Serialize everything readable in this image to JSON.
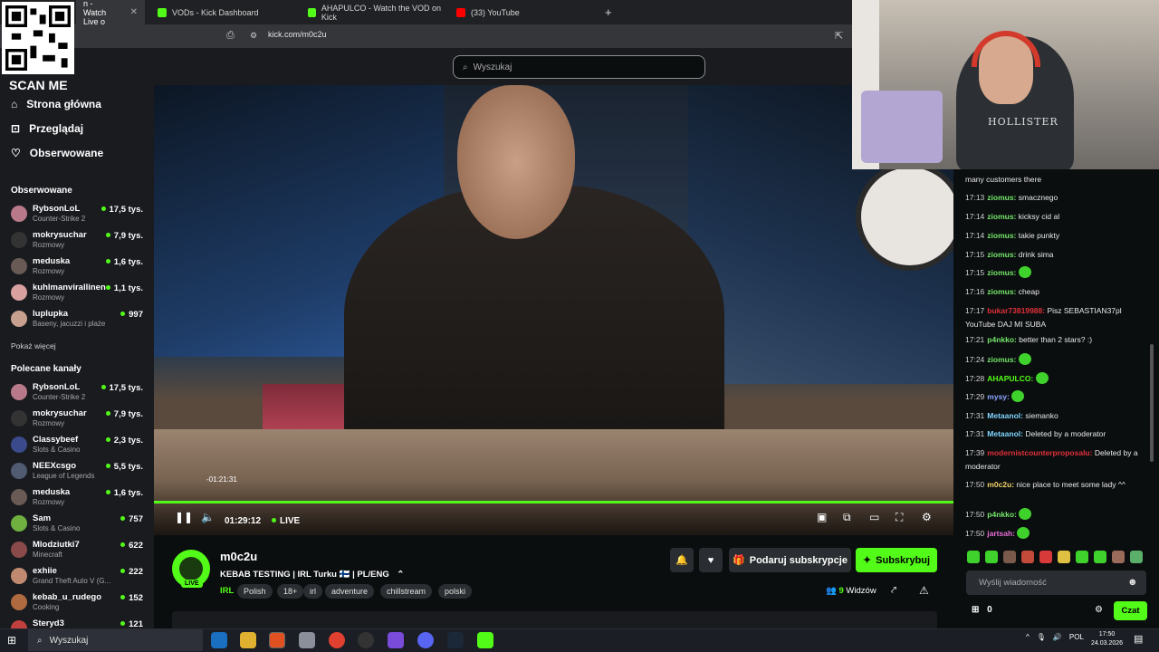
{
  "browser": {
    "tabs": [
      {
        "label": "n - Watch Live o",
        "color": "#53fc18"
      },
      {
        "label": "VODs - Kick Dashboard",
        "color": "#53fc18"
      },
      {
        "label": "AHAPULCO - Watch the VOD on Kick",
        "color": "#53fc18"
      },
      {
        "label": "(33) YouTube",
        "color": "#ff0000"
      }
    ],
    "url": "kick.com/m0c2u"
  },
  "overlay": {
    "scan_me": "SCAN ME"
  },
  "header": {
    "search_placeholder": "Wyszukaj"
  },
  "sidebar": {
    "nav": [
      {
        "label": "Strona główna",
        "icon": "home-icon"
      },
      {
        "label": "Przeglądaj",
        "icon": "browse-icon"
      },
      {
        "label": "Obserwowane",
        "icon": "heart-icon"
      }
    ],
    "followed_title": "Obserwowane",
    "followed": [
      {
        "name": "RybsonLoL",
        "category": "Counter-Strike 2",
        "viewers": "17,5 tys.",
        "color": "#b87a8a"
      },
      {
        "name": "mokrysuchar",
        "category": "Rozmowy",
        "viewers": "7,9 tys.",
        "color": "#333"
      },
      {
        "name": "meduska",
        "category": "Rozmowy",
        "viewers": "1,6 tys.",
        "color": "#6a5a55"
      },
      {
        "name": "kuhlmanvirallinen",
        "category": "Rozmowy",
        "viewers": "1,1 tys.",
        "color": "#d9a0a0"
      },
      {
        "name": "luplupka",
        "category": "Baseny, jacuzzi i plaże",
        "viewers": "997",
        "color": "#c8a090"
      }
    ],
    "show_more": "Pokaż więcej",
    "recommended_title": "Polecane kanały",
    "recommended": [
      {
        "name": "RybsonLoL",
        "category": "Counter-Strike 2",
        "viewers": "17,5 tys.",
        "color": "#b87a8a"
      },
      {
        "name": "mokrysuchar",
        "category": "Rozmowy",
        "viewers": "7,9 tys.",
        "color": "#333"
      },
      {
        "name": "Classybeef",
        "category": "Slots & Casino",
        "viewers": "2,3 tys.",
        "color": "#3a4a8a"
      },
      {
        "name": "NEEXcsgo",
        "category": "League of Legends",
        "viewers": "5,5 tys.",
        "color": "#505a70"
      },
      {
        "name": "meduska",
        "category": "Rozmowy",
        "viewers": "1,6 tys.",
        "color": "#6a5a55"
      },
      {
        "name": "Sam",
        "category": "Slots & Casino",
        "viewers": "757",
        "color": "#6fb040"
      },
      {
        "name": "Mlodziutki7",
        "category": "Minecraft",
        "viewers": "622",
        "color": "#8a4a4a"
      },
      {
        "name": "exhiie",
        "category": "Grand Theft Auto V (G...",
        "viewers": "222",
        "color": "#c08a70"
      },
      {
        "name": "kebab_u_rudego",
        "category": "Cooking",
        "viewers": "152",
        "color": "#b06a40"
      },
      {
        "name": "Steryd3",
        "category": "",
        "viewers": "121",
        "color": "#c04040"
      }
    ]
  },
  "player": {
    "hover_time": "-01:21:31",
    "current_time": "01:29:12",
    "live_label": "LIVE",
    "progress": 1.0
  },
  "stream": {
    "streamer": "m0c2u",
    "live_tag": "LIVE",
    "title": "KEBAB TESTING | IRL Turku 🇫🇮 | PL/ENG",
    "category": "IRL",
    "tags": [
      "Polish",
      "18+",
      "irl",
      "adventure",
      "chillstream",
      "polski"
    ],
    "gift_label": "Podaruj subskrypcje",
    "subscribe_label": "Subskrybuj",
    "viewers_count": "9",
    "viewers_label": "Widzów"
  },
  "webcam": {
    "shirt_text": "HOLLISTER"
  },
  "chat": {
    "messages": [
      {
        "time": "",
        "user": "",
        "text": "many customers there",
        "color": "#53fc18"
      },
      {
        "time": "17:13",
        "user": "ziomus:",
        "text": "smacznego",
        "color": "#74e66b"
      },
      {
        "time": "17:14",
        "user": "ziomus:",
        "text": "kicksy cid al",
        "color": "#74e66b"
      },
      {
        "time": "17:14",
        "user": "ziomus:",
        "text": "takie punkty",
        "color": "#74e66b"
      },
      {
        "time": "17:15",
        "user": "ziomus:",
        "text": "drink sima",
        "color": "#74e66b"
      },
      {
        "time": "17:15",
        "user": "ziomus:",
        "text": "",
        "color": "#74e66b",
        "emote": true
      },
      {
        "time": "17:16",
        "user": "ziomus:",
        "text": "cheap",
        "color": "#74e66b"
      },
      {
        "time": "17:17",
        "user": "bukar73819988:",
        "text": "Pisz SEBASTIAN37pl YouTube DAJ MI SUBA",
        "color": "#e0303a"
      },
      {
        "time": "17:21",
        "user": "p4nkko:",
        "text": "better than 2 stars? :)",
        "color": "#74e66b"
      },
      {
        "time": "17:24",
        "user": "ziomus:",
        "text": "",
        "color": "#74e66b",
        "emote": true
      },
      {
        "time": "17:28",
        "user": "AHAPULCO:",
        "text": "",
        "color": "#53fc18",
        "emote": true
      },
      {
        "time": "17:29",
        "user": "mysy:",
        "text": "",
        "color": "#8aa6ff",
        "emote": true
      },
      {
        "time": "17:31",
        "user": "Metaanol:",
        "text": "siemanko",
        "color": "#7fd6ff"
      },
      {
        "time": "17:31",
        "user": "Metaanol:",
        "text": "Deleted by a moderator",
        "color": "#7fd6ff"
      },
      {
        "time": "17:39",
        "user": "modernistcounterproposalu:",
        "text": "Deleted by a moderator",
        "color": "#e0303a"
      },
      {
        "time": "17:50",
        "user": "m0c2u:",
        "text": "nice place to meet some lady ^^",
        "color": "#f2d36a"
      },
      {
        "time": "17:50",
        "user": "p4nkko:",
        "text": "",
        "color": "#74e66b",
        "emote": true
      },
      {
        "time": "17:50",
        "user": "jartsah:",
        "text": "",
        "color": "#e86fd8",
        "emote": true
      }
    ],
    "input_placeholder": "Wyślij wiadomość",
    "points": "0",
    "chat_button": "Czat"
  },
  "taskbar": {
    "search_label": "Wyszukaj",
    "lang": "POL",
    "time": "17:50",
    "date": "24.03.2026"
  }
}
